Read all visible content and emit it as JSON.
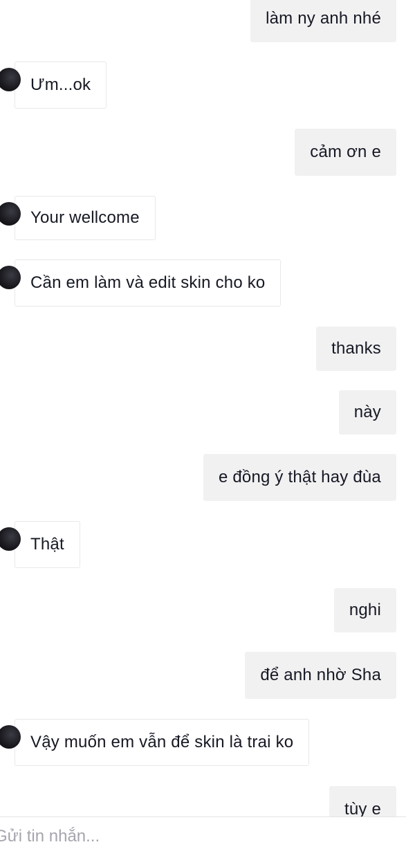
{
  "messages": [
    {
      "side": "me",
      "text": "làm ny anh nhé"
    },
    {
      "side": "them",
      "text": "Ưm...ok",
      "avatar": true
    },
    {
      "side": "me",
      "text": "cảm ơn e"
    },
    {
      "side": "them",
      "text": "Your wellcome",
      "avatar": true
    },
    {
      "side": "them",
      "text": "Cần em làm và edit skin cho ko",
      "avatar": true
    },
    {
      "side": "me",
      "text": "thanks"
    },
    {
      "side": "me",
      "text": "này"
    },
    {
      "side": "me",
      "text": "e đồng ý thật hay đùa"
    },
    {
      "side": "them",
      "text": "Thật",
      "avatar": true
    },
    {
      "side": "me",
      "text": "nghi"
    },
    {
      "side": "me",
      "text": "để anh nhờ Sha"
    },
    {
      "side": "them",
      "text": "Vậy muốn em vẫn để skin là trai ko",
      "avatar": true
    },
    {
      "side": "me",
      "text": "tùy e"
    }
  ],
  "composer": {
    "placeholder": "Gửi tin nhắn...",
    "value": ""
  },
  "colors": {
    "own_bubble": "#f1f1f2",
    "other_bubble_border": "#e8e8ea",
    "text": "#161823",
    "placeholder": "#a5a6ad"
  }
}
